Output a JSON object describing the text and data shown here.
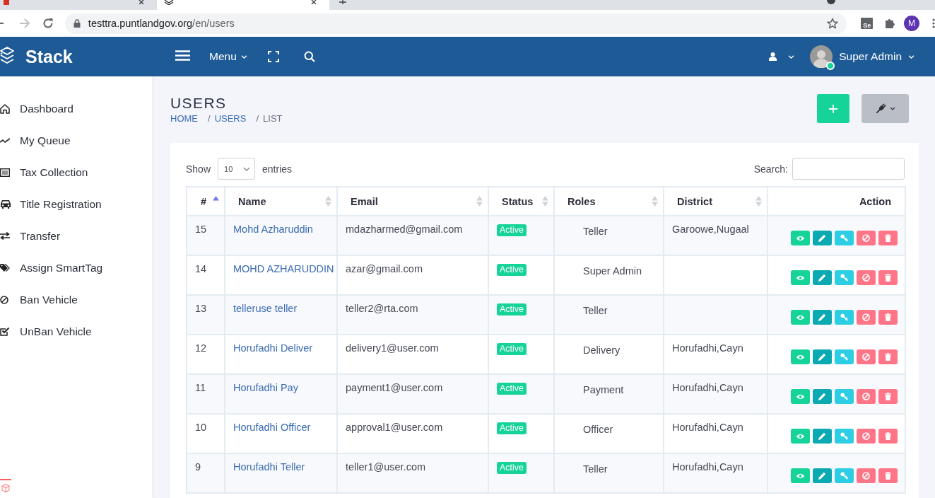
{
  "browser": {
    "tabs": [
      {
        "selected": false
      },
      {
        "selected": true
      }
    ],
    "forward_enabled": false,
    "url_host": "testtra.puntlandgov.org",
    "url_path": "/en/users",
    "extension_label": "Se",
    "profile_initial": "M"
  },
  "header": {
    "brand": "Stack",
    "menu_label": "Menu",
    "user_name": "Super Admin",
    "user_online": true
  },
  "sidebar": {
    "items": [
      {
        "label": "Dashboard",
        "selected": false
      },
      {
        "label": "My Queue",
        "selected": false
      },
      {
        "label": "Tax Collection",
        "selected": false
      },
      {
        "label": "Title Registration",
        "selected": false
      },
      {
        "label": "Transfer",
        "selected": false
      },
      {
        "label": "Assign SmartTag",
        "selected": false
      },
      {
        "label": "Ban Vehicle",
        "selected": false
      },
      {
        "label": "UnBan Vehicle",
        "selected": false
      }
    ]
  },
  "page": {
    "title": "USERS",
    "breadcrumb": [
      {
        "label": "HOME",
        "current": false
      },
      {
        "separator": "/",
        "label": "USERS",
        "current": false
      },
      {
        "separator": "/",
        "label": "LIST",
        "current": true
      }
    ]
  },
  "table_controls": {
    "show_label": "Show",
    "page_size": "10",
    "entries_label": "entries",
    "search_label": "Search:"
  },
  "table": {
    "columns": [
      {
        "label": "#",
        "sortable": true,
        "sorted": true
      },
      {
        "label": "Name",
        "sortable": true,
        "sorted": false
      },
      {
        "label": "Email",
        "sortable": true,
        "sorted": false
      },
      {
        "label": "Status",
        "sortable": true,
        "sorted": false
      },
      {
        "label": "Roles",
        "sortable": true,
        "sorted": false
      },
      {
        "label": "District",
        "sortable": true,
        "sorted": false
      },
      {
        "label": "Action",
        "sortable": false
      }
    ],
    "row_actions": [
      {
        "kind": "view"
      },
      {
        "kind": "edit"
      },
      {
        "kind": "key"
      },
      {
        "kind": "ban"
      },
      {
        "kind": "delete"
      }
    ],
    "rows": [
      {
        "id": "15",
        "name": "Mohd Azharuddin",
        "email": "mdazharmed@gmail.com",
        "status": "Active",
        "role": "Teller",
        "district": "Garoowe,Nugaal"
      },
      {
        "id": "14",
        "name": "MOHD AZHARUDDIN",
        "email": "azar@gmail.com",
        "status": "Active",
        "role": "Super Admin"
      },
      {
        "id": "13",
        "name": "telleruse teller",
        "email": "teller2@rta.com",
        "status": "Active",
        "role": "Teller"
      },
      {
        "id": "12",
        "name": "Horufadhi Deliver",
        "email": "delivery1@user.com",
        "status": "Active",
        "role": "Delivery",
        "district": "Horufadhi,Cayn"
      },
      {
        "id": "11",
        "name": "Horufadhi Pay",
        "email": "payment1@user.com",
        "status": "Active",
        "role": "Payment",
        "district": "Horufadhi,Cayn"
      },
      {
        "id": "10",
        "name": "Horufadhi Officer",
        "email": "approval1@user.com",
        "status": "Active",
        "role": "Officer",
        "district": "Horufadhi,Cayn"
      },
      {
        "id": "9",
        "name": "Horufadhi Teller",
        "email": "teller1@user.com",
        "status": "Active",
        "role": "Teller",
        "district": "Horufadhi,Cayn"
      }
    ]
  }
}
